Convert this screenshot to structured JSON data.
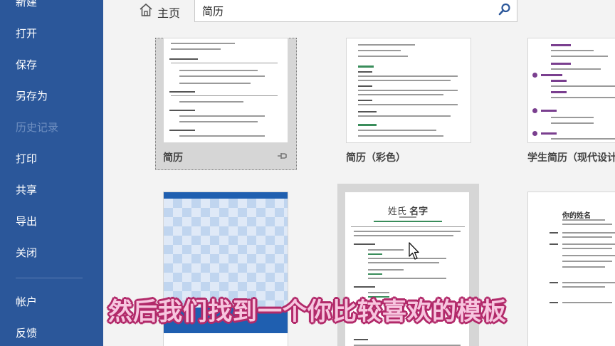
{
  "sidebar": {
    "items": [
      {
        "label": "新建"
      },
      {
        "label": "打开"
      },
      {
        "label": "保存"
      },
      {
        "label": "另存为"
      },
      {
        "label": "历史记录",
        "disabled": true
      },
      {
        "label": "打印"
      },
      {
        "label": "共享"
      },
      {
        "label": "导出"
      },
      {
        "label": "关闭"
      },
      {
        "label": "帐户"
      },
      {
        "label": "反馈"
      }
    ]
  },
  "header": {
    "home_label": "主页",
    "search_value": "简历"
  },
  "templates": [
    {
      "label": "简历",
      "selected": true,
      "pinned": true
    },
    {
      "label": "简历（彩色）"
    },
    {
      "label": "学生简历（现代设计"
    },
    {
      "label": ""
    },
    {
      "label": "",
      "heading_surname": "姓氏",
      "heading_name": "名字"
    },
    {
      "label": "",
      "heading": "你的姓名"
    }
  ],
  "subtitle": "然后我们找到一个你比较喜欢的模板",
  "colors": {
    "sidebar": "#2b579a",
    "accent_green": "#3a8d5b",
    "accent_purple": "#7a3f8f",
    "banner_blue": "#1f5fb0"
  }
}
